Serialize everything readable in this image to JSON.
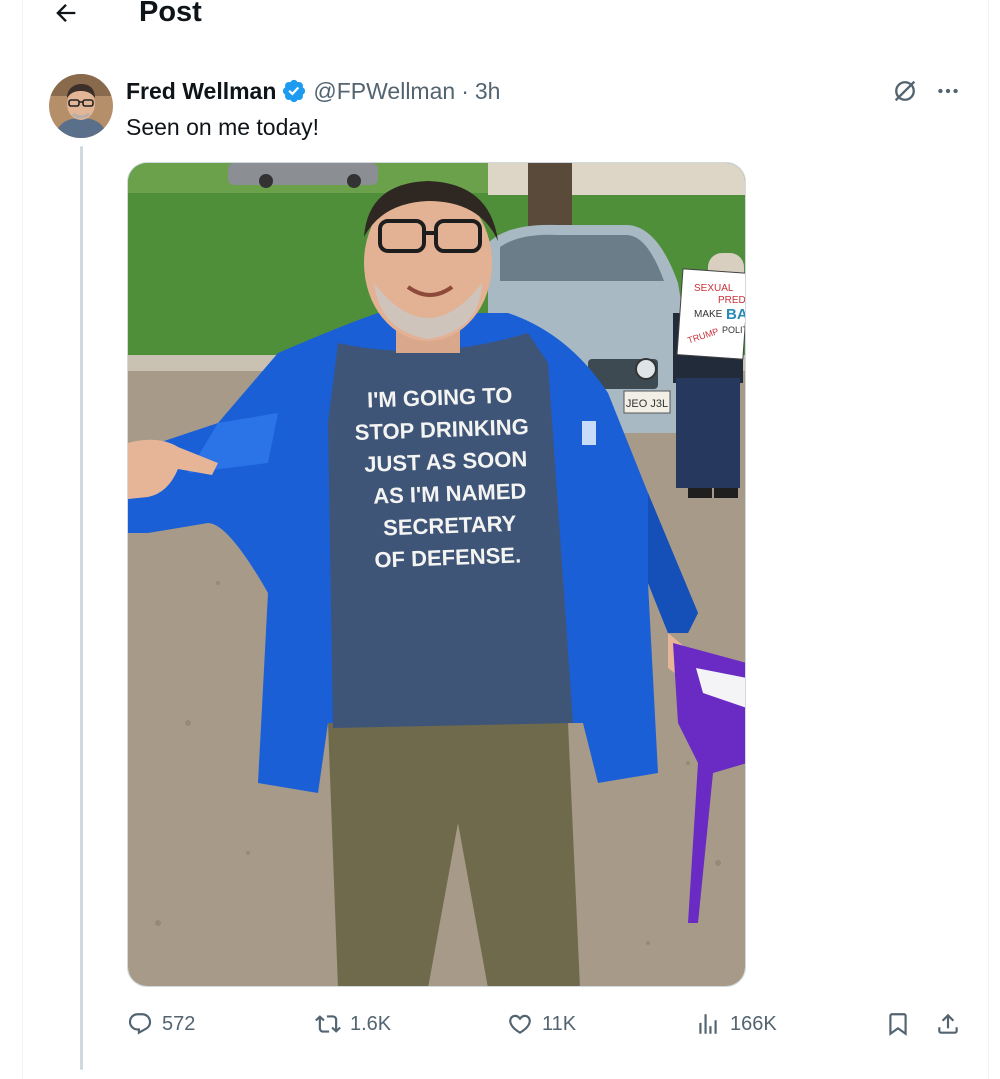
{
  "header": {
    "title": "Post"
  },
  "post": {
    "author": {
      "name": "Fred Wellman",
      "handle": "@FPWellman",
      "verified": true
    },
    "separator": "·",
    "time": "3h",
    "text": "Seen on me today!",
    "image": {
      "shirt_lines": [
        "I'M GOING TO",
        "STOP DRINKING",
        "JUST AS SOON",
        "AS I'M NAMED",
        "SECRETARY",
        "OF DEFENSE."
      ],
      "sign_lines": [
        "SEXUAL",
        "PRED",
        "MAKE",
        "BA",
        "TRUMP",
        "POLIT"
      ],
      "plate": "JEO J3L"
    },
    "stats": {
      "replies": "572",
      "reposts": "1.6K",
      "likes": "11K",
      "views": "166K"
    }
  },
  "icons": {
    "back": "arrow-left-icon",
    "verified": "verified-badge-icon",
    "grok": "grok-icon",
    "more": "more-dots-icon",
    "reply": "reply-icon",
    "repost": "repost-icon",
    "like": "heart-icon",
    "views": "views-chart-icon",
    "bookmark": "bookmark-icon",
    "share": "share-icon"
  },
  "colors": {
    "text_primary": "#0f1419",
    "text_secondary": "#536471",
    "verified_blue": "#1d9bf0",
    "border": "#cfd9de"
  }
}
